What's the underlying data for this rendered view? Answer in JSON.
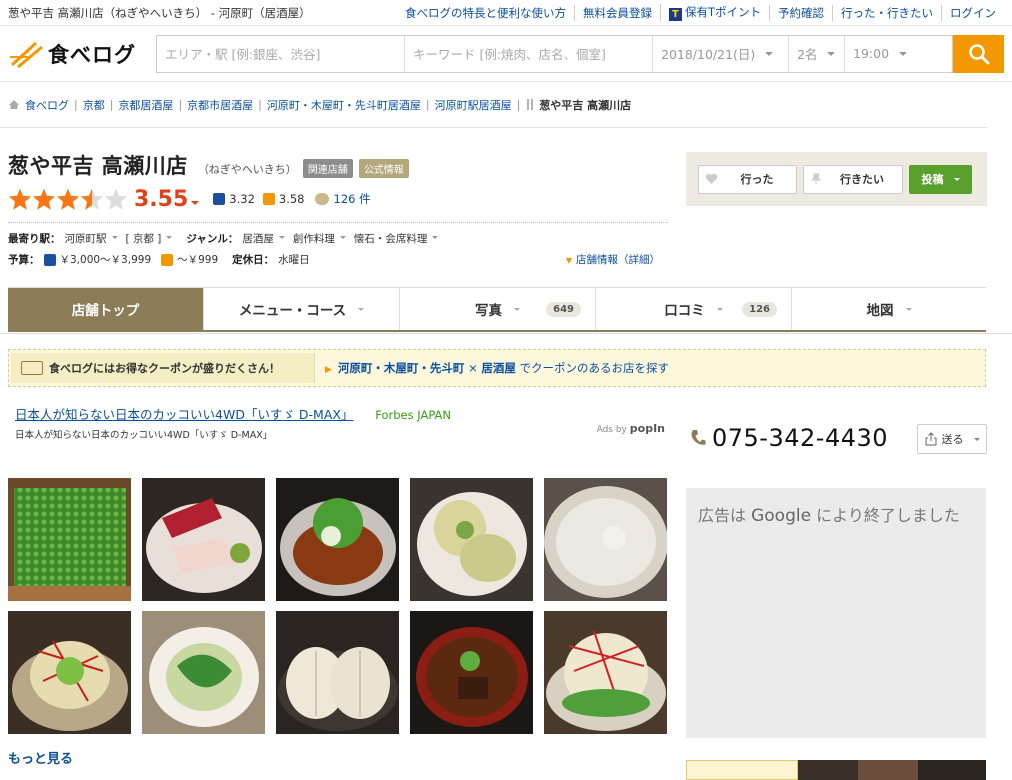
{
  "topbar": {
    "page_title": "葱や平吉 高瀬川店（ねぎやへいきち） - 河原町（居酒屋）",
    "links": [
      "食べログの特長と便利な使い方",
      "無料会員登録",
      "保有Tポイント",
      "予約確認",
      "行った・行きたい",
      "ログイン"
    ],
    "tpoint_icon_glyph": "T"
  },
  "header": {
    "logo_text": "食べログ",
    "area_placeholder": "エリア・駅 [例:銀座、渋谷]",
    "keyword_placeholder": "キーワード [例:焼肉、店名、個室]",
    "date": "2018/10/21(日)",
    "people": "2名",
    "time": "19:00",
    "brand_color": "#f39800"
  },
  "breadcrumb": {
    "items": [
      "食べログ",
      "京都",
      "京都居酒屋",
      "京都市居酒屋",
      "河原町・木屋町・先斗町居酒屋",
      "河原町駅居酒屋"
    ],
    "current": "葱や平吉 高瀬川店"
  },
  "restaurant": {
    "name": "葱や平吉 高瀬川店",
    "kana": "（ねぎやへいきち）",
    "tag_related": "関連店舗",
    "tag_official": "公式情報",
    "score": "3.55",
    "dinner_score": "3.32",
    "lunch_score": "3.58",
    "reviews_count": "126 件",
    "star_rating": 3.55,
    "nearest_label": "最寄り駅：",
    "nearest_station": "河原町駅",
    "nearest_area": "[ 京都 ]",
    "genre_label": "ジャンル：",
    "genres": [
      "居酒屋",
      "創作料理",
      "懐石・会席料理"
    ],
    "budget_label": "予算：",
    "dinner_budget": "￥3,000～￥3,999",
    "lunch_budget": "～￥999",
    "holiday_label": "定休日：",
    "holiday": "水曜日",
    "detail_link": "店舗情報（詳細）"
  },
  "actions": {
    "went": "行った",
    "want": "行きたい",
    "post": "投稿"
  },
  "tabs": [
    {
      "label": "店舗トップ",
      "count": ""
    },
    {
      "label": "メニュー・コース",
      "count": ""
    },
    {
      "label": "写真",
      "count": "649"
    },
    {
      "label": "口コミ",
      "count": "126"
    },
    {
      "label": "地図",
      "count": ""
    }
  ],
  "coupon": {
    "left_text": "食べログにはお得なクーポンが盛りだくさん！",
    "area_link": "河原町・木屋町・先斗町",
    "times": "×",
    "genre_link": "居酒屋",
    "suffix": "でクーポンのあるお店を探す"
  },
  "ad": {
    "title": "日本人が知らない日本のカッコいい4WD「いすゞ D-MAX」",
    "source": "Forbes JAPAN",
    "desc": "日本人が知らない日本のカッコいい4WD「いすゞ D-MAX」",
    "ads_by": "Ads by",
    "ads_brand": "popIn"
  },
  "photos": [
    {
      "subject": "green onions in wooden box"
    },
    {
      "subject": "sashimi platter"
    },
    {
      "subject": "green onion braised beef"
    },
    {
      "subject": "vegetable tempura"
    },
    {
      "subject": "creamy tofu in bowl"
    },
    {
      "subject": "salad with chili threads"
    },
    {
      "subject": "greens in bowl"
    },
    {
      "subject": "grilled onion"
    },
    {
      "subject": "simmered dish in red bowl"
    },
    {
      "subject": "green onion salad"
    }
  ],
  "more_link": "もっと見る",
  "phone": {
    "number": "075-342-4430",
    "send_label": "送る"
  },
  "google_ad": {
    "prefix": "広告は",
    "brand": "Google",
    "suffix": "により終了しました"
  }
}
